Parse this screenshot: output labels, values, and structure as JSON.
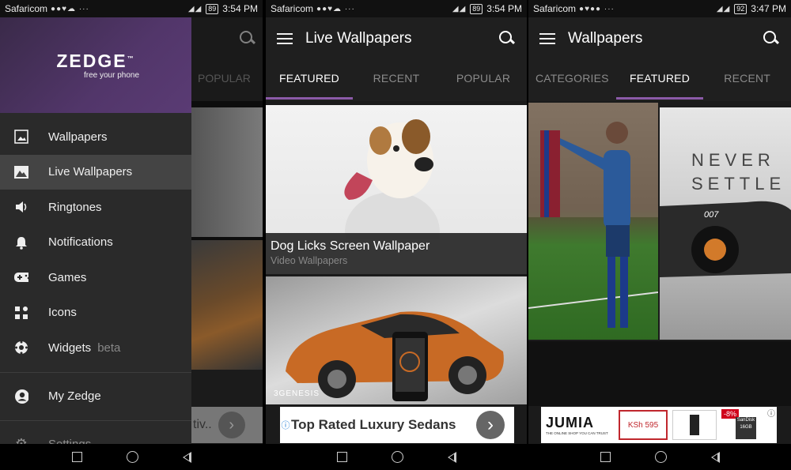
{
  "status_bars": [
    {
      "carrier": "Safaricom",
      "icons": "●●♥☁ ···",
      "battery": "89",
      "time": "3:54 PM"
    },
    {
      "carrier": "Safaricom",
      "icons": "●●♥☁ ···",
      "battery": "89",
      "time": "3:54 PM"
    },
    {
      "carrier": "Safaricom",
      "icons": "●♥●● ···",
      "battery": "92",
      "time": "3:47 PM"
    }
  ],
  "drawer": {
    "logo": "ZEDGE",
    "logo_tm": "™",
    "tagline": "free your phone",
    "items": [
      {
        "label": "Wallpapers",
        "icon": "image-icon"
      },
      {
        "label": "Live Wallpapers",
        "icon": "landscape-icon"
      },
      {
        "label": "Ringtones",
        "icon": "speaker-icon"
      },
      {
        "label": "Notifications",
        "icon": "bell-icon"
      },
      {
        "label": "Games",
        "icon": "gamepad-icon"
      },
      {
        "label": "Icons",
        "icon": "grid-icon"
      },
      {
        "label": "Widgets",
        "icon": "soccer-icon",
        "badge": "beta"
      }
    ],
    "my_zedge": "My Zedge",
    "settings": "Settings",
    "behind_tab": "POPULAR",
    "behind_ad": "tiv.."
  },
  "screen2": {
    "title": "Live Wallpapers",
    "tabs": [
      "FEATURED",
      "RECENT",
      "POPULAR"
    ],
    "active_tab": 0,
    "items": [
      {
        "title": "Dog Licks Screen Wallpaper",
        "subtitle": "Video Wallpapers"
      },
      {
        "logo_text": "3GENESIS"
      }
    ],
    "ad_text": "Top Rated Luxury Sedans"
  },
  "screen3": {
    "title": "Wallpapers",
    "tabs": [
      "CATEGORIES",
      "FEATURED",
      "RECENT"
    ],
    "active_tab": 1,
    "wall_text": [
      "NEVER",
      "SETTLE"
    ],
    "car_badge": "007",
    "ad": {
      "brand": "JUMIA",
      "brand_sub": "THE ONLINE SHOP YOU CAN TRUST",
      "price": "KSh 595",
      "discount": "-8%",
      "card_brand": "SanDisk",
      "card_size": "16GB"
    }
  },
  "colors": {
    "accent": "#8b5aa8",
    "drawer_head": "#52366a",
    "toolbar": "#1f1f1f"
  }
}
